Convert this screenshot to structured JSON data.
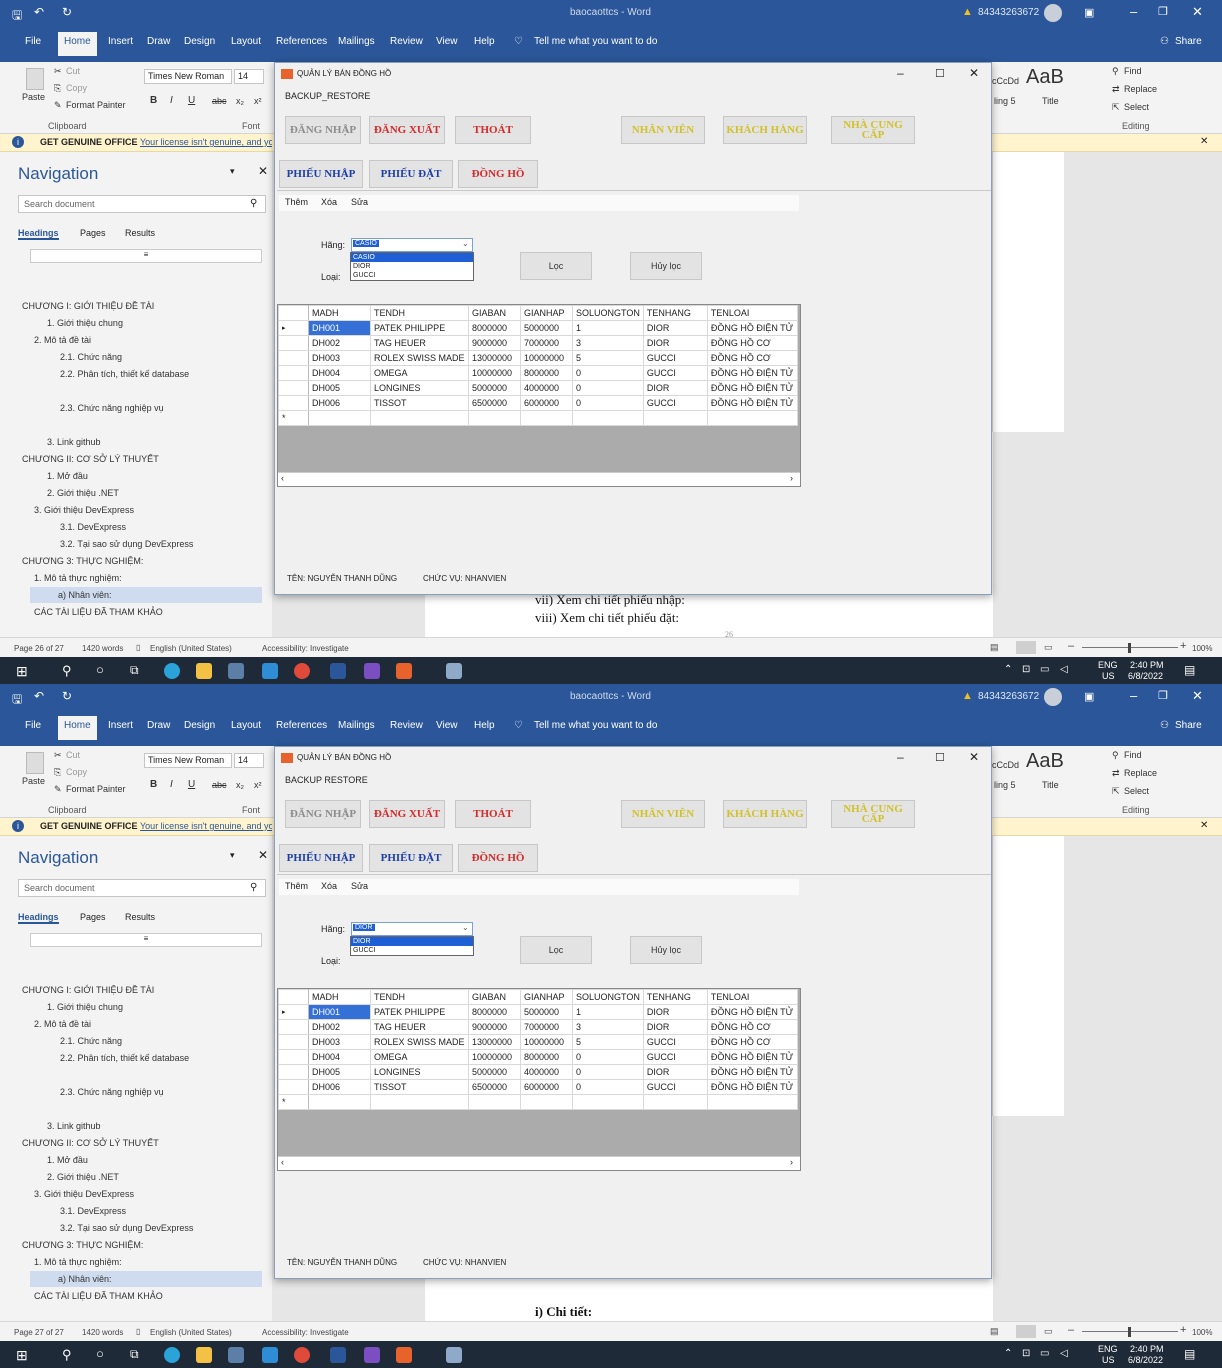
{
  "word": {
    "title": "baocaottcs - Word",
    "user": "84343263672",
    "share": "Share",
    "tabs": [
      "File",
      "Home",
      "Insert",
      "Draw",
      "Design",
      "Layout",
      "References",
      "Mailings",
      "Review",
      "View",
      "Help"
    ],
    "tell": "Tell me what you want to do",
    "clipboard": {
      "paste": "Paste",
      "cut": "Cut",
      "copy": "Copy",
      "painter": "Format Painter",
      "label": "Clipboard"
    },
    "font": {
      "name": "Times New Roman",
      "size": "14",
      "label": "Font"
    },
    "styles": {
      "aab": "AaB",
      "heading": "ling 5",
      "title": "Title",
      "ccdd": "cCcDd"
    },
    "editing": {
      "find": "Find",
      "replace": "Replace",
      "select": "Select",
      "label": "Editing"
    },
    "banner": {
      "title": "GET GENUINE OFFICE",
      "link": "Your license isn't genuine, and yo"
    },
    "nav": {
      "title": "Navigation",
      "search": "Search document",
      "tabs": [
        "Headings",
        "Pages",
        "Results"
      ],
      "items": [
        "CHƯƠNG I: GIỚI THIỆU ĐỀ TÀI",
        "1. Giới thiệu chung",
        "2. Mô tả đề tài",
        "2.1. Chức năng",
        "2.2. Phân tích, thiết kế database",
        "2.3. Chức năng nghiệp vụ",
        "3. Link github",
        "CHƯƠNG II: CƠ SỞ LÝ THUYẾT",
        "1. Mở đầu",
        "2. Giới thiệu .NET",
        "3. Giới thiệu DevExpress",
        "3.1. DevExpress",
        "3.2. Tại sao sử dụng DevExpress",
        "CHƯƠNG 3: THỰC NGHIỆM:",
        "1. Mô tả thực nghiệm:",
        "a) Nhân viên:",
        "CÁC TÀI LIỆU ĐÃ THAM KHẢO"
      ]
    },
    "status": {
      "page1": "Page 26 of 27",
      "page2": "Page 27 of 27",
      "words": "1420 words",
      "lang": "English (United States)",
      "access": "Accessibility: Investigate",
      "zoom": "100%"
    },
    "doc": {
      "line1": "vii)   Xem chi tiết phiếu nhập:",
      "line2": "viii)  Xem chi tiết phiếu đặt:",
      "pagenum": "26",
      "line3": "i) Chi tiết:"
    },
    "taskbar": {
      "lang": "ENG",
      "region": "US",
      "time": "2:40 PM",
      "date": "6/8/2022"
    }
  },
  "app": {
    "title": "QUẢN LÝ BÁN ĐỒNG HỒ",
    "menu": "BACKUP_RESTORE",
    "menu2": "BACKUP  RESTORE",
    "buttons": {
      "login": "ĐĂNG NHẬP",
      "logout": "ĐĂNG XUẤT",
      "exit": "THOÁT",
      "staff": "NHÂN VIÊN",
      "customer": "KHÁCH HÀNG",
      "supplier": "NHÀ CUNG CẤP",
      "import": "PHIẾU NHẬP",
      "order": "PHIẾU ĐẶT",
      "watch": "ĐỒNG HỒ"
    },
    "toolbar": [
      "Thêm",
      "Xóa",
      "Sửa"
    ],
    "filter": {
      "hang_label": "Hãng:",
      "loai_label": "Loại:",
      "loc": "Lọc",
      "huy": "Hủy lọc"
    },
    "hang_options": [
      "CASIO",
      "DIOR",
      "GUCCI"
    ],
    "shot1_selected": "CASIO",
    "shot2_selected": "DIOR",
    "shot2_loai": "ĐỒNG HỒ ĐIỆN TỬ",
    "columns": [
      "MADH",
      "TENDH",
      "GIABAN",
      "GIANHAP",
      "SOLUONGTON",
      "TENHANG",
      "TENLOAI"
    ],
    "rows": [
      [
        "DH001",
        "PATEK PHILIPPE",
        "8000000",
        "5000000",
        "1",
        "DIOR",
        "ĐỒNG HỒ ĐIỆN TỬ"
      ],
      [
        "DH002",
        "TAG HEUER",
        "9000000",
        "7000000",
        "3",
        "DIOR",
        "ĐỒNG HỒ CƠ"
      ],
      [
        "DH003",
        "ROLEX SWISS MADE",
        "13000000",
        "10000000",
        "5",
        "GUCCI",
        "ĐỒNG HỒ CƠ"
      ],
      [
        "DH004",
        "OMEGA",
        "10000000",
        "8000000",
        "0",
        "GUCCI",
        "ĐỒNG HỒ ĐIỆN TỬ"
      ],
      [
        "DH005",
        "LONGINES",
        "5000000",
        "4000000",
        "0",
        "DIOR",
        "ĐỒNG HỒ ĐIỆN TỬ"
      ],
      [
        "DH006",
        "TISSOT",
        "6500000",
        "6000000",
        "0",
        "GUCCI",
        "ĐỒNG HỒ ĐIỆN TỬ"
      ]
    ],
    "footer": {
      "ten": "TÊN: NGUYỄN THANH DŨNG",
      "chucvu": "CHỨC VỤ:  NHANVIEN"
    }
  }
}
